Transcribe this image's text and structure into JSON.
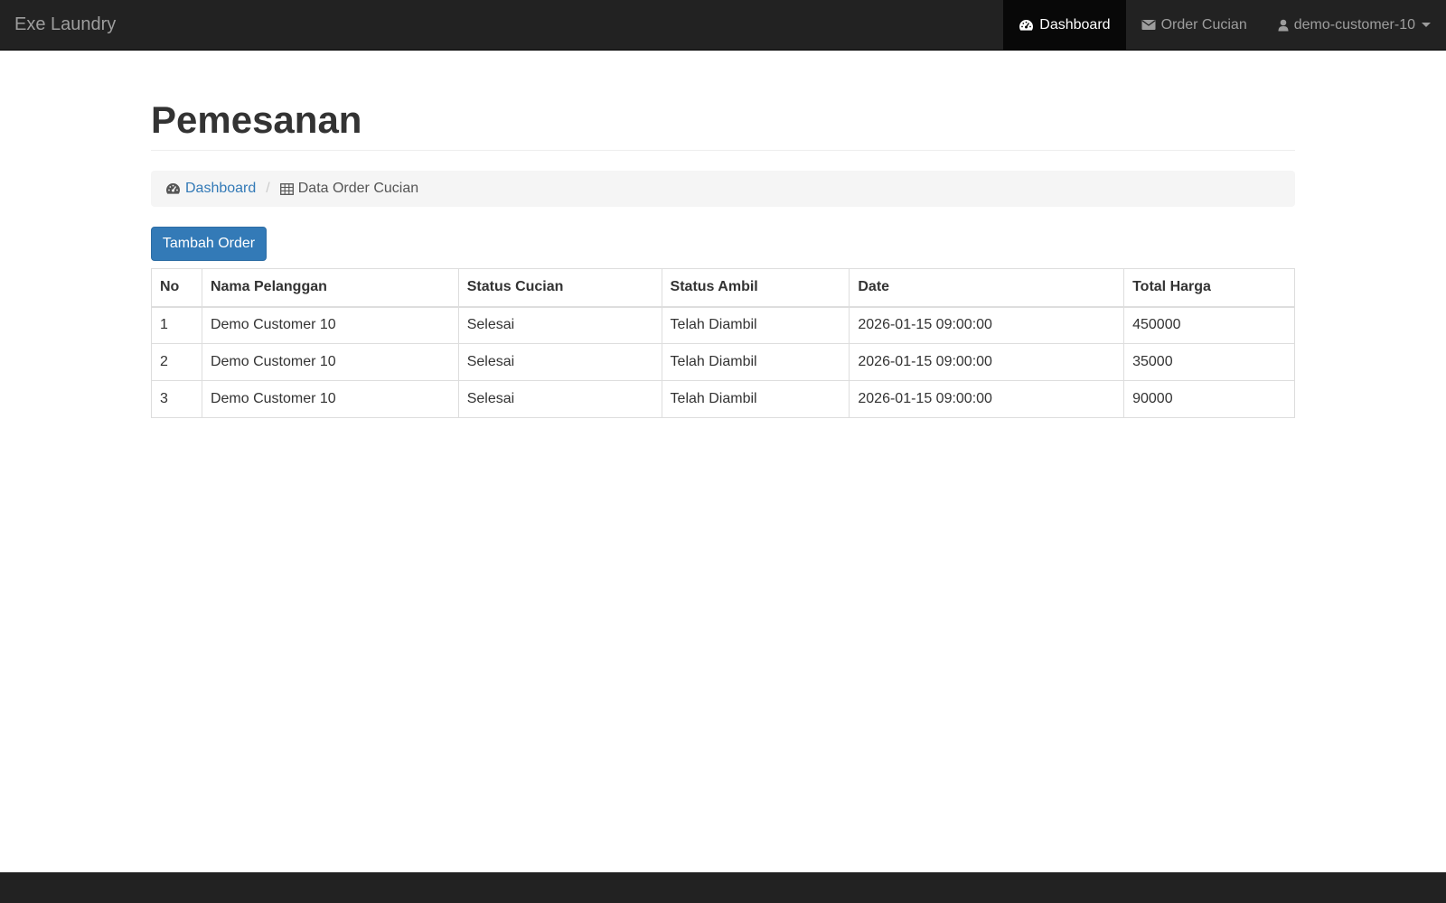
{
  "navbar": {
    "brand": "Exe Laundry",
    "items": [
      {
        "label": "Dashboard",
        "icon": "dashboard-icon",
        "active": true
      },
      {
        "label": "Order Cucian",
        "icon": "envelope-icon",
        "active": false
      },
      {
        "label": "demo-customer-10",
        "icon": "user-icon",
        "active": false
      }
    ]
  },
  "page": {
    "title": "Pemesanan"
  },
  "breadcrumb": {
    "home_label": "Dashboard",
    "current_label": "Data Order Cucian"
  },
  "actions": {
    "add_order_label": "Tambah Order"
  },
  "table": {
    "headers": [
      "No",
      "Nama Pelanggan",
      "Status Cucian",
      "Status Ambil",
      "Date",
      "Total Harga"
    ],
    "rows": [
      [
        "1",
        "Demo Customer 10",
        "Selesai",
        "Telah Diambil",
        "2026-01-15 09:00:00",
        "450000"
      ],
      [
        "2",
        "Demo Customer 10",
        "Selesai",
        "Telah Diambil",
        "2026-01-15 09:00:00",
        "35000"
      ],
      [
        "3",
        "Demo Customer 10",
        "Selesai",
        "Telah Diambil",
        "2026-01-15 09:00:00",
        "90000"
      ]
    ]
  },
  "colors": {
    "navbar_bg": "#222222",
    "navbar_active_bg": "#080808",
    "primary": "#337ab7",
    "link": "#337ab7"
  }
}
